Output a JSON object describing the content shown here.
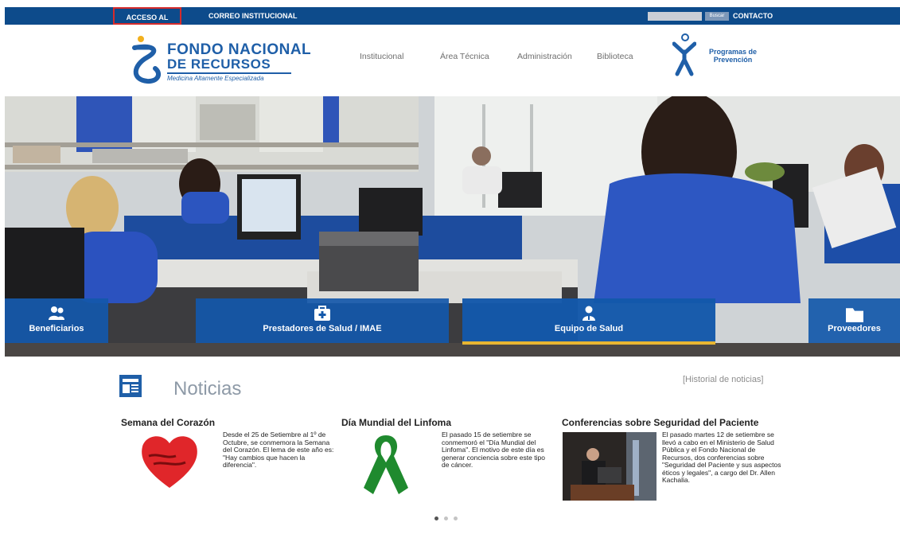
{
  "topbar": {
    "portal_label": "ACCESO AL PORTAL",
    "correo_label": "CORREO INSTITUCIONAL",
    "search_button_label": "Buscar",
    "contact_label": "CONTACTO"
  },
  "header": {
    "logo_line1": "FONDO NACIONAL",
    "logo_line2": "DE RECURSOS",
    "logo_subtitle": "Medicina Altamente Especializada",
    "nav": [
      "Institucional",
      "Área Técnica",
      "Administración",
      "Biblioteca"
    ],
    "programs_label_1": "Programas de",
    "programs_label_2": "Prevención"
  },
  "categories": [
    {
      "label": "Beneficiarios",
      "icon": "users-icon"
    },
    {
      "label": "Prestadores de Salud / IMAE",
      "icon": "medical-kit-icon"
    },
    {
      "label": "Equipo de Salud",
      "icon": "health-worker-icon"
    },
    {
      "label": "Proveedores",
      "icon": "folder-icon"
    }
  ],
  "news": {
    "section_title": "Noticias",
    "history_link": "[Historial de noticias]",
    "items": [
      {
        "title": "Semana del Corazón",
        "text": "Desde el 25 de Setiembre al 1º de Octubre, se conmemora la Semana del Corazón. El lema de este año es: \"Hay cambios que hacen la diferencia\"."
      },
      {
        "title": "Día Mundial del Linfoma",
        "text": "El pasado 15 de setiembre se conmemoró el \"Día Mundial del Linfoma\". El motivo de este día es generar conciencia sobre este tipo de cáncer."
      },
      {
        "title": "Conferencias sobre Seguridad del Paciente",
        "text": "El pasado martes 12 de setiembre se llevó a cabo en el Ministerio de Salud Pública y el Fondo Nacional de Recursos, dos conferencias sobre \"Seguridad del Paciente y sus aspectos éticos y legales\", a cargo del Dr. Allen Kachalia."
      }
    ]
  },
  "colors": {
    "topbar": "#0d4b8b",
    "brand_blue": "#1f5fa8",
    "category_bar": "#1358aa",
    "active_underline": "#e7b532"
  }
}
